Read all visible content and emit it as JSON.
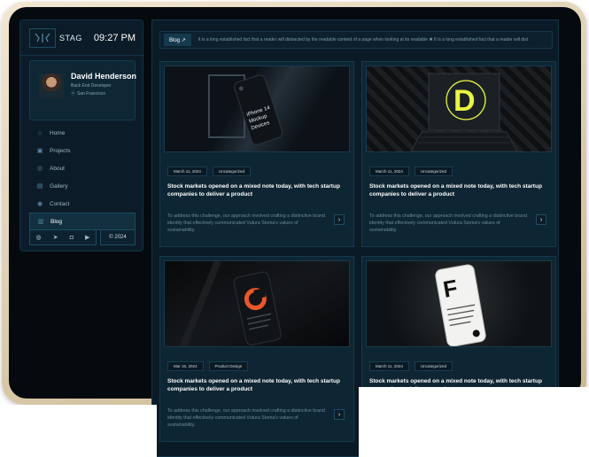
{
  "sidebar": {
    "brand": "STAG",
    "time": "09:27 PM",
    "profile": {
      "name": "David Henderson",
      "role": "Back End Developer",
      "location": "San Francisco"
    },
    "nav": [
      {
        "label": "Home",
        "icon": "home-icon"
      },
      {
        "label": "Projects",
        "icon": "projects-icon"
      },
      {
        "label": "About",
        "icon": "about-icon"
      },
      {
        "label": "Gallery",
        "icon": "gallery-icon"
      },
      {
        "label": "Contact",
        "icon": "contact-icon"
      },
      {
        "label": "Blog",
        "icon": "blog-icon"
      }
    ],
    "social": [
      "dribbble-icon",
      "telegram-icon",
      "instagram-icon",
      "youtube-icon"
    ],
    "copyright": "© 2024"
  },
  "topbar": {
    "tag": "Blog ↗",
    "marquee": "It is a long established fact that a reader will distracted by the readable content of a page when looking at its readable ✖ It is a long established fact that a reader will dist"
  },
  "cards": [
    {
      "date": "March 11, 2024",
      "category": "Uncategorized",
      "title": "Stock markets opened on a mixed note today, with tech startup companies to deliver a product",
      "desc": "To address this challenge, our approach involved crafting a distinctive brand identity that effectively communicated Vutura Sioma's values of sustainability.",
      "image": "iphone-14-mockup",
      "screen_text": "iPhone 14 Mockup Devices"
    },
    {
      "date": "March 11, 2024",
      "category": "Uncategorized",
      "title": "Stock markets opened on a mixed note today, with tech startup companies to deliver a product",
      "desc": "To address this challenge, our approach involved crafting a distinctive brand identity that effectively communicated Vutura Sioma's values of sustainability.",
      "image": "laptop-d-mockup",
      "screen_text": "D"
    },
    {
      "date": "Mar 16, 2024",
      "category": "Product Design",
      "title": "Stock markets opened on a mixed note today, with tech startup companies to deliver a product",
      "desc": "To address this challenge, our approach involved crafting a distinctive brand identity that effectively communicated Vutura Sioma's values of sustainability.",
      "image": "phone-c-mockup",
      "screen_text": "C"
    },
    {
      "date": "March 11, 2024",
      "category": "Uncategorized",
      "title": "Stock markets opened on a mixed note today, with tech startup companies to deliver a product",
      "desc": "",
      "image": "phone-f-mockup",
      "screen_text": "F"
    }
  ],
  "colors": {
    "accent": "#e9f542",
    "panel": "#0b1c28",
    "orange": "#e8572a"
  }
}
